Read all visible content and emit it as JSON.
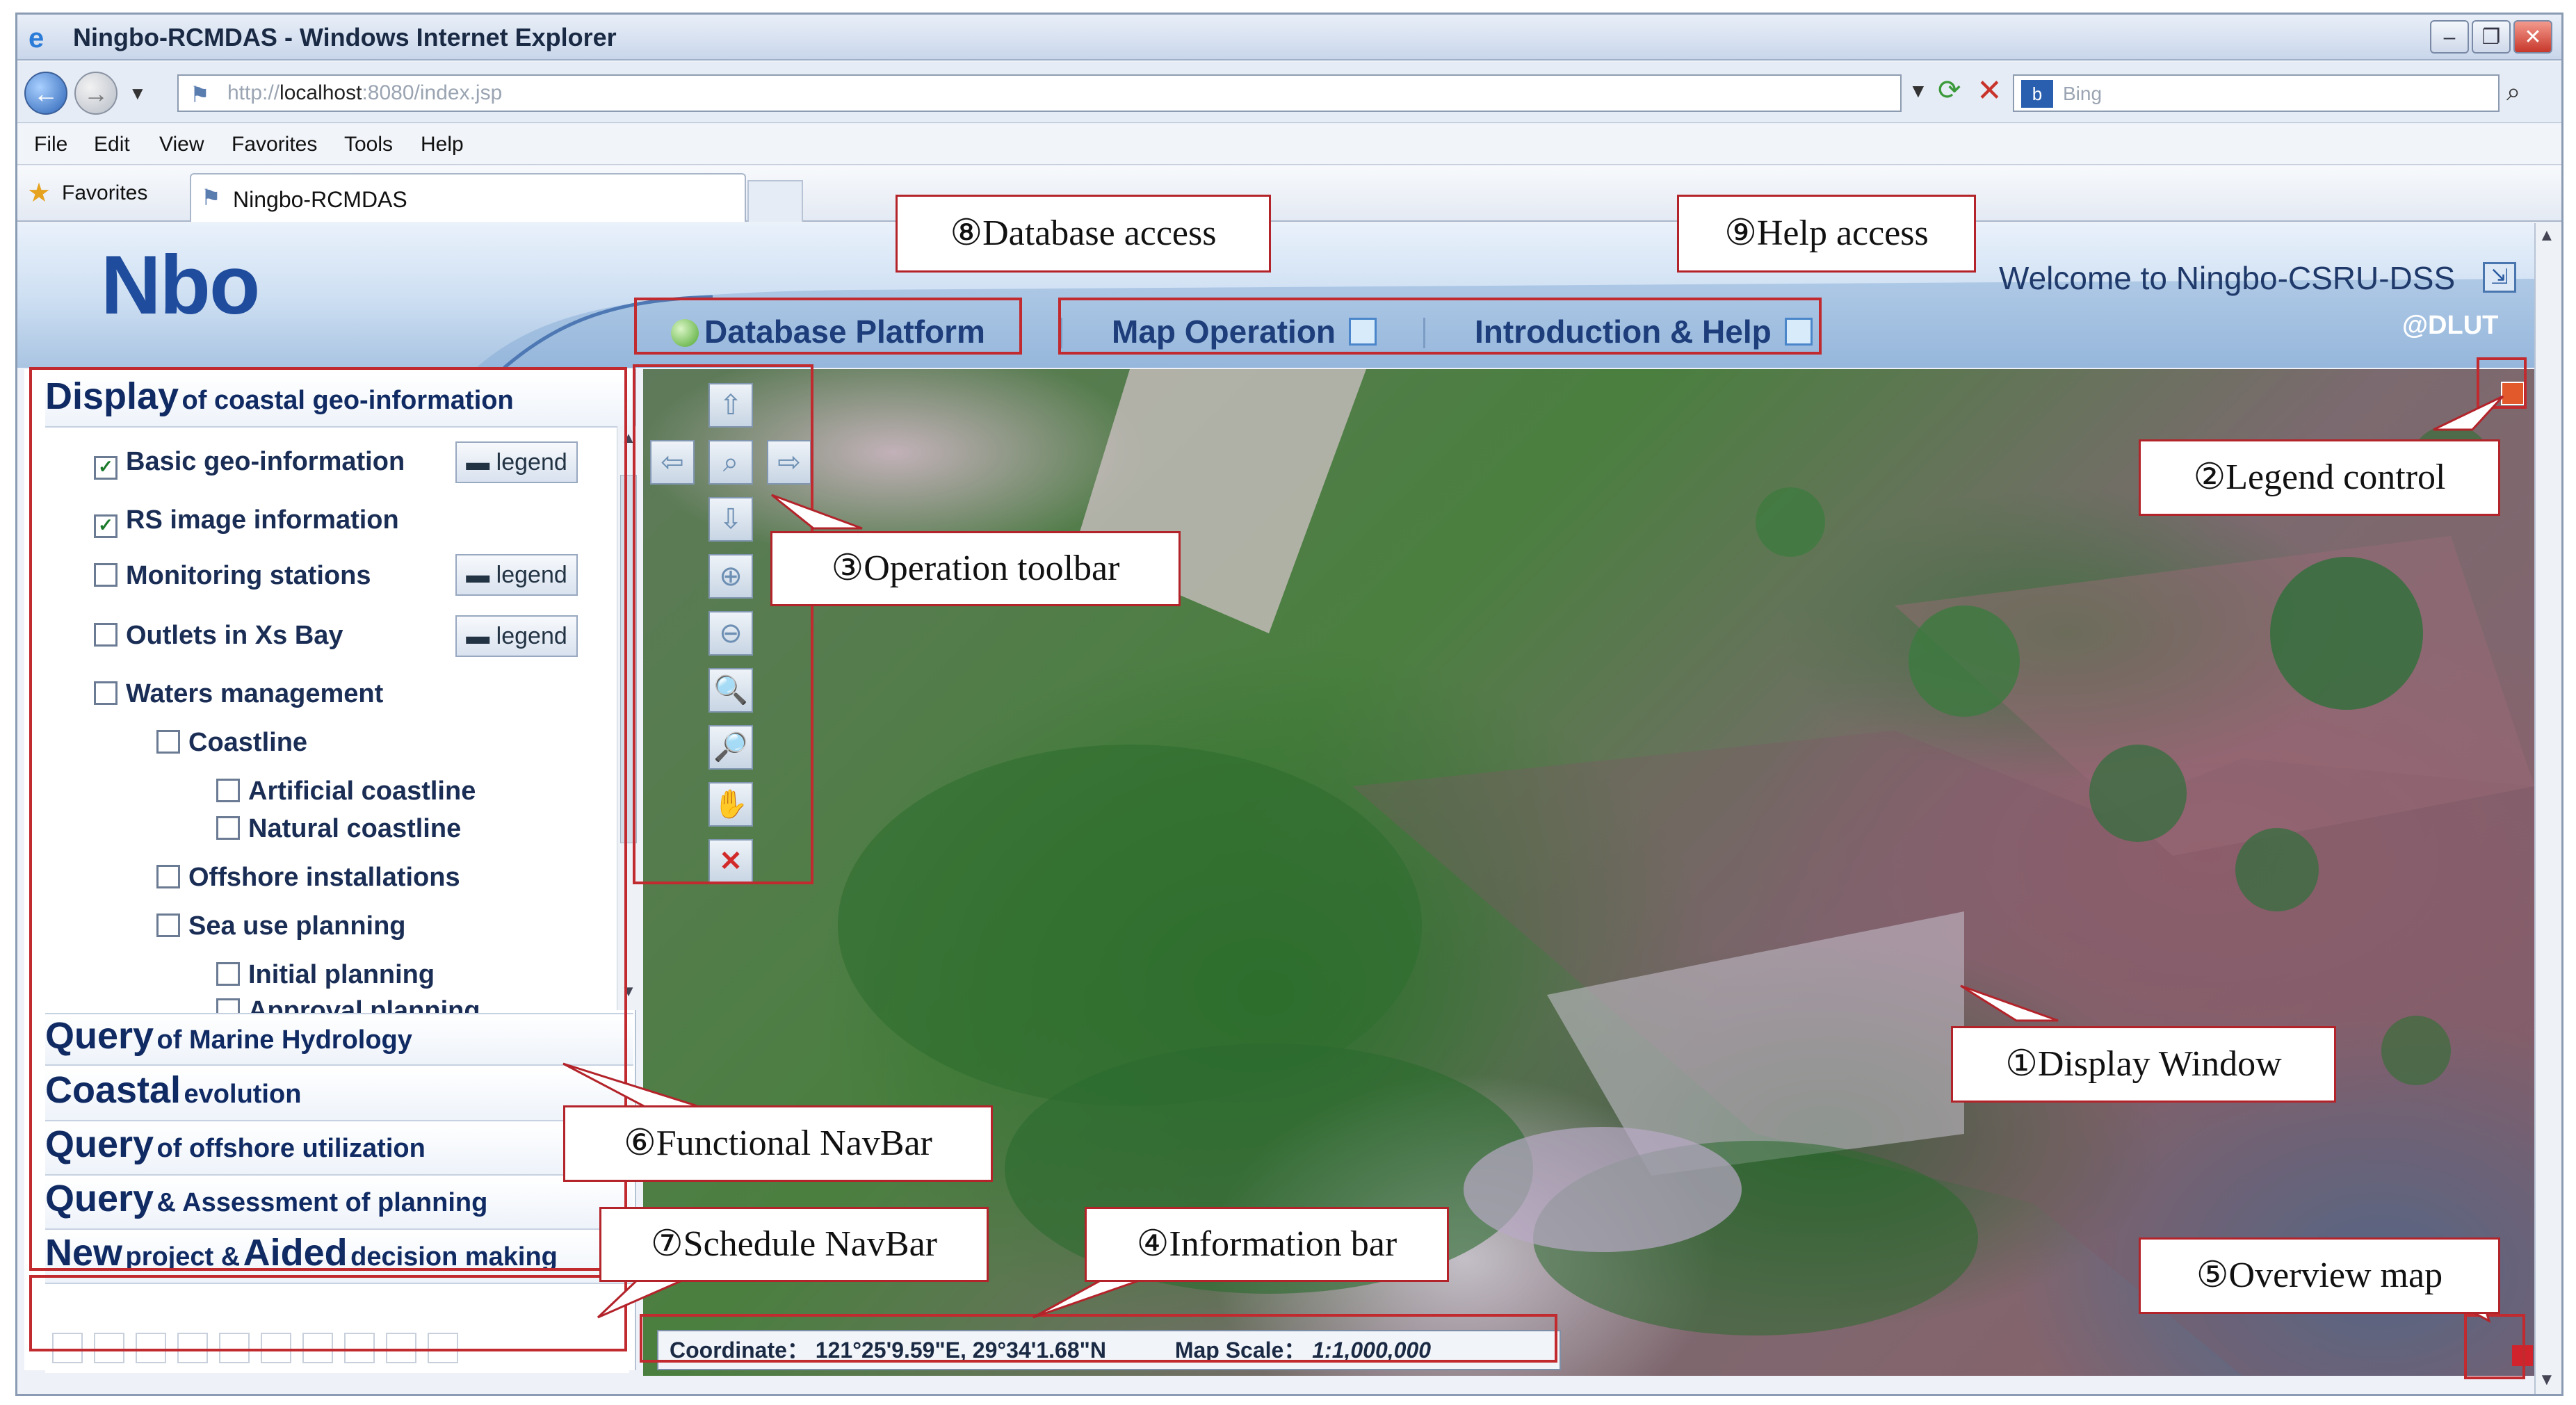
{
  "window": {
    "title": "Ningbo-RCMDAS - Windows Internet Explorer"
  },
  "browser": {
    "address_prefix": "http://",
    "address_host": "localhost",
    "address_rest": ":8080/index.jsp",
    "search_placeholder": "Bing",
    "menu": [
      "File",
      "Edit",
      "View",
      "Favorites",
      "Tools",
      "Help"
    ],
    "favorites_label": "Favorites",
    "tab_title": "Ningbo-RCMDAS"
  },
  "app": {
    "logo": "Nbo",
    "welcome": "Welcome to Ningbo-CSRU-DSS",
    "credit": "@DLUT",
    "topnav": [
      "Database Platform",
      "Map Operation",
      "Introduction & Help"
    ]
  },
  "sidebar": {
    "display_head_big": "Display",
    "display_head_small": "of coastal geo-information",
    "legend_label": "legend",
    "tree": [
      {
        "label": "Basic geo-information",
        "checked": true
      },
      {
        "label": "RS image information",
        "checked": true
      },
      {
        "label": "Monitoring stations",
        "checked": false
      },
      {
        "label": "Outlets in Xs Bay",
        "checked": false
      },
      {
        "label": "Waters management",
        "checked": false
      },
      {
        "label": "Coastline",
        "checked": false
      },
      {
        "label": "Artificial coastline",
        "checked": false
      },
      {
        "label": "Natural coastline",
        "checked": false
      },
      {
        "label": "Offshore installations",
        "checked": false
      },
      {
        "label": "Sea use planning",
        "checked": false
      },
      {
        "label": "Initial planning",
        "checked": false
      },
      {
        "label": "Approval planning",
        "checked": false
      }
    ],
    "sections": [
      {
        "big": "Query",
        "small": "of Marine Hydrology"
      },
      {
        "big": "Coastal",
        "small": "evolution"
      },
      {
        "big": "Query",
        "small": "of offshore utilization"
      },
      {
        "big": "Query",
        "small": "& Assessment of planning"
      },
      {
        "big": "New",
        "small": "project &",
        "big2": "Aided",
        "small2": "decision making"
      }
    ]
  },
  "map": {
    "info_coordinate_label": "Coordinate：",
    "info_coordinate_value": "121°25'9.59\"E, 29°34'1.68\"N",
    "info_scale_label": "Map Scale：",
    "info_scale_value": "1:1,000,000"
  },
  "callouts": {
    "display_window": "①Display Window",
    "legend_control": "②Legend control",
    "operation_toolbar": "③Operation toolbar",
    "information_bar": "④Information bar",
    "overview_map": "⑤Overview map",
    "functional_navbar": "⑥Functional NavBar",
    "schedule_navbar": "⑦Schedule NavBar",
    "database_access": "⑧Database access",
    "help_access": "⑨Help access"
  }
}
